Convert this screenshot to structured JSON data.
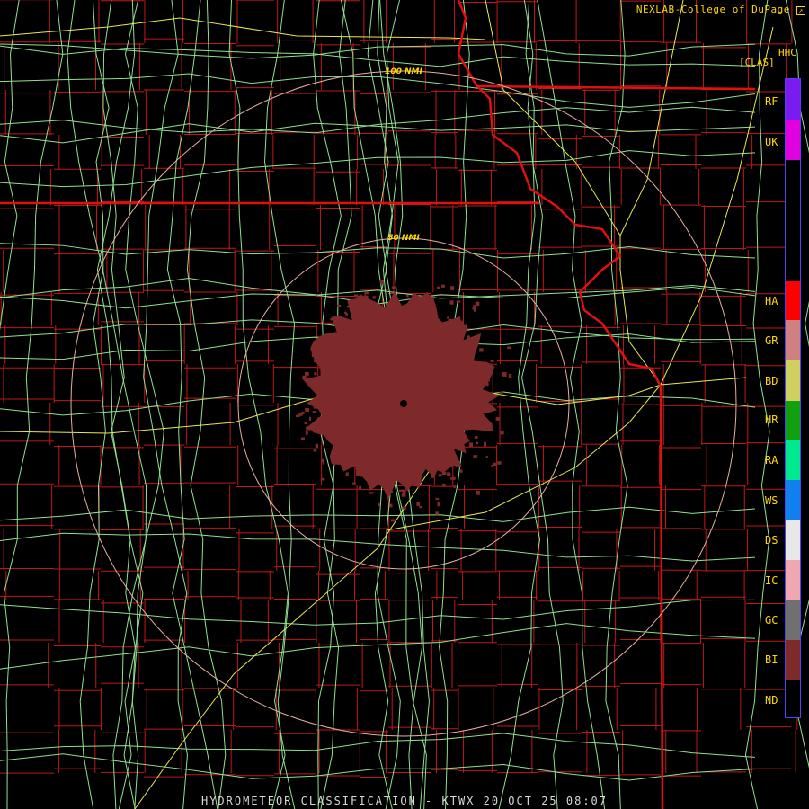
{
  "credit": "NEXLAB-College of DuPage",
  "product_code": "HHC",
  "units": "[CLAS]",
  "footer": "HYDROMETEOR CLASSIFICATION - KTWX 20 OCT 25 08:07",
  "range_rings": [
    "50 NMI",
    "100 NMI"
  ],
  "colors": {
    "background": "#000000",
    "county_lines": "#c01818",
    "state_lines": "#e01010",
    "roads_minor": "#90e090",
    "roads_major": "#e8e850",
    "rings": "#e6b0a0",
    "echo": "#7e2a2a"
  },
  "legend": [
    {
      "code": "RF",
      "color": "#7a1cf0"
    },
    {
      "code": "UK",
      "color": "#e000e0"
    },
    {
      "code": "HA",
      "color": "#ff0000"
    },
    {
      "code": "GR",
      "color": "#d08080"
    },
    {
      "code": "BD",
      "color": "#d0d060"
    },
    {
      "code": "HR",
      "color": "#10a010"
    },
    {
      "code": "RA",
      "color": "#00e890"
    },
    {
      "code": "WS",
      "color": "#1080f0"
    },
    {
      "code": "DS",
      "color": "#e8e8e8"
    },
    {
      "code": "IC",
      "color": "#f0a8b0"
    },
    {
      "code": "GC",
      "color": "#707070"
    },
    {
      "code": "BI",
      "color": "#7e2a2a"
    },
    {
      "code": "ND",
      "color": "#000000"
    }
  ]
}
